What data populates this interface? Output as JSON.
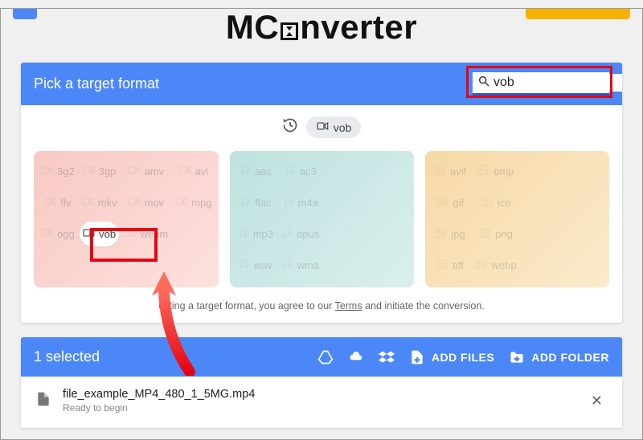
{
  "brand": {
    "pre": "MC",
    "post": "nverter"
  },
  "picker": {
    "title": "Pick a target format",
    "search_value": "vob",
    "recent": {
      "label": "vob"
    },
    "agree_pre": "ecting a target format, you agree to our ",
    "agree_link": "Terms",
    "agree_post": " and initiate the conversion.",
    "groups": {
      "video": [
        "3g2",
        "3gp",
        "amv",
        "avi",
        "flv",
        "mkv",
        "mov",
        "mpg",
        "ogg",
        "vob",
        "webm",
        ""
      ],
      "audio": [
        "aac",
        "ac3",
        "",
        "",
        "flac",
        "m4a",
        "",
        "",
        "mp3",
        "opus",
        "",
        "",
        "wav",
        "wma",
        "",
        ""
      ],
      "image": [
        "avif",
        "bmp",
        "",
        "",
        "gif",
        "ico",
        "",
        "",
        "jpg",
        "png",
        "",
        "",
        "tiff",
        "webp",
        "",
        ""
      ]
    },
    "active_format": "vob"
  },
  "queue": {
    "selected_label": "1 selected",
    "buttons": {
      "add_files": "ADD FILES",
      "add_folder": "ADD FOLDER"
    },
    "file": {
      "name": "file_example_MP4_480_1_5MG.mp4",
      "status": "Ready to begin"
    }
  }
}
